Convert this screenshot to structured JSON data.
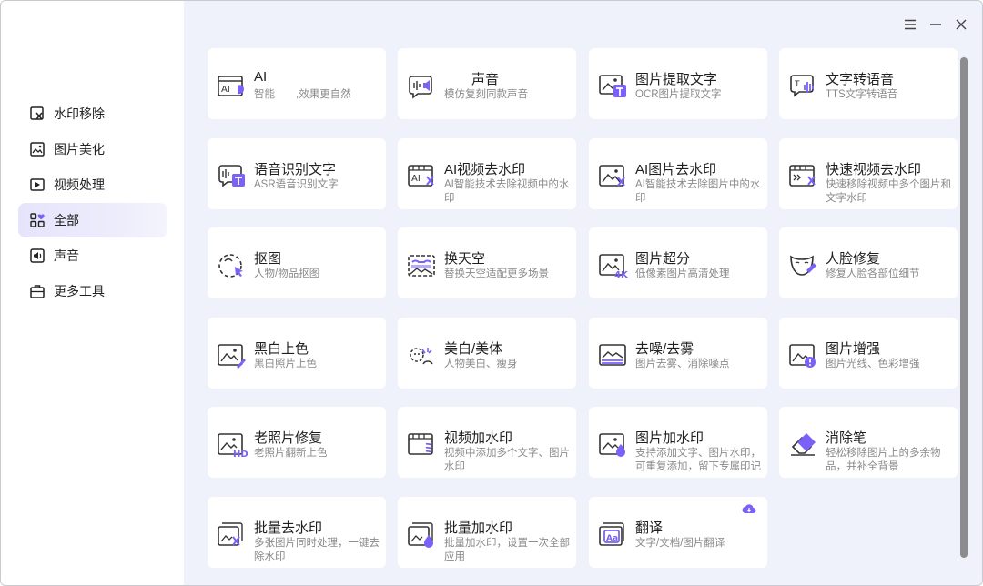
{
  "window_controls": {
    "menu": "menu-icon",
    "minimize": "minimize-icon",
    "close": "close-icon"
  },
  "sidebar": {
    "items": [
      {
        "label": "水印移除",
        "icon": "watermark-remove-icon"
      },
      {
        "label": "图片美化",
        "icon": "image-beautify-icon"
      },
      {
        "label": "视频处理",
        "icon": "video-icon"
      },
      {
        "label": "全部",
        "icon": "grid-icon",
        "active": true
      },
      {
        "label": "声音",
        "icon": "sound-icon"
      },
      {
        "label": "更多工具",
        "icon": "toolbox-icon"
      }
    ]
  },
  "colors": {
    "accent": "#7b61f8",
    "sidebar_active": "#e6e4fb",
    "content_bg": "#eff1fb"
  },
  "tools": [
    {
      "title": "AI",
      "desc": "智能　　,效果更自然",
      "icon": "ai-icon"
    },
    {
      "title": "　　声音",
      "desc": "模仿复刻同款声音",
      "icon": "voice-clone-icon"
    },
    {
      "title": "图片提取文字",
      "desc": "OCR图片提取文字",
      "icon": "image-ocr-icon"
    },
    {
      "title": "文字转语音",
      "desc": "TTS文字转语音",
      "icon": "tts-icon"
    },
    {
      "title": "语音识别文字",
      "desc": "ASR语音识别文字",
      "icon": "asr-icon"
    },
    {
      "title": "AI视频去水印",
      "desc": "AI智能技术去除视频中的水印",
      "icon": "ai-video-watermark-icon"
    },
    {
      "title": "AI图片去水印",
      "desc": "AI智能技术去除图片中的水印",
      "icon": "ai-image-watermark-icon"
    },
    {
      "title": "快速视频去水印",
      "desc": "快速移除视频中多个图片和文字水印",
      "icon": "fast-video-watermark-icon"
    },
    {
      "title": "抠图",
      "desc": "人物/物品抠图",
      "icon": "cutout-icon"
    },
    {
      "title": "换天空",
      "desc": "替换天空适配更多场景",
      "icon": "sky-replace-icon"
    },
    {
      "title": "图片超分",
      "desc": "低像素图片高清处理",
      "icon": "super-resolution-icon"
    },
    {
      "title": "人脸修复",
      "desc": "修复人脸各部位细节",
      "icon": "face-restore-icon"
    },
    {
      "title": "黑白上色",
      "desc": "黑白照片上色",
      "icon": "colorize-icon"
    },
    {
      "title": "美白/美体",
      "desc": "人物美白、瘦身",
      "icon": "beautify-body-icon"
    },
    {
      "title": "去噪/去雾",
      "desc": "图片去雾、消除噪点",
      "icon": "denoise-icon"
    },
    {
      "title": "图片增强",
      "desc": "图片光线、色彩增强",
      "icon": "enhance-icon"
    },
    {
      "title": "老照片修复",
      "desc": "老照片翻新上色",
      "icon": "old-photo-icon"
    },
    {
      "title": "视频加水印",
      "desc": "视频中添加多个文字、图片水印",
      "icon": "video-add-watermark-icon"
    },
    {
      "title": "图片加水印",
      "desc": "支持添加文字、图片水印，可重复添加，留下专属印记",
      "icon": "image-add-watermark-icon"
    },
    {
      "title": "消除笔",
      "desc": "轻松移除图片上的多余物品，并补全背景",
      "icon": "eraser-icon"
    },
    {
      "title": "批量去水印",
      "desc": "多张图片同时处理，一键去除水印",
      "icon": "batch-remove-watermark-icon"
    },
    {
      "title": "批量加水印",
      "desc": "批量加水印，设置一次全部应用",
      "icon": "batch-add-watermark-icon"
    },
    {
      "title": "翻译",
      "desc": "文字/文档/图片翻译",
      "icon": "translate-icon",
      "badge": "cloud-download-icon"
    }
  ]
}
